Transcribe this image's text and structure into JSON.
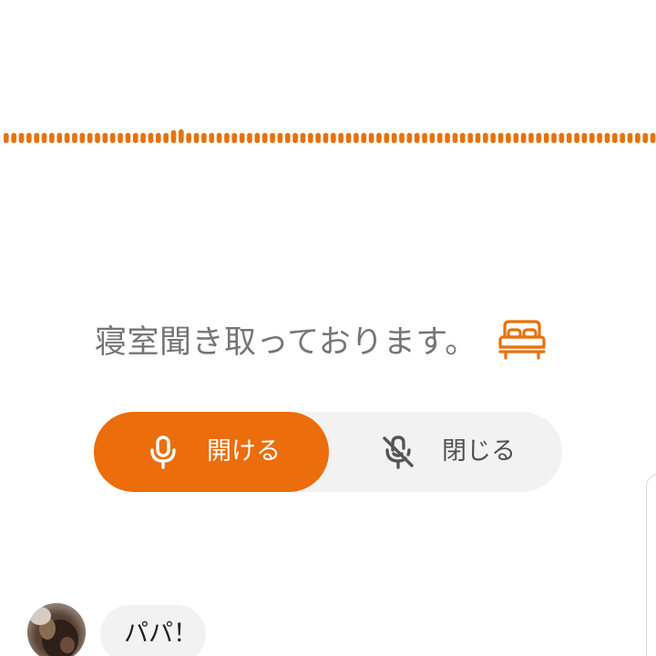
{
  "waveform": {
    "color": "#e8720c",
    "icon": "audio-waveform"
  },
  "status": {
    "text": "寝室聞き取っております。",
    "icon": "bed-icon",
    "icon_color": "#e8720c"
  },
  "toggle": {
    "open": {
      "label": "開ける",
      "icon": "microphone-icon",
      "selected": true,
      "background": "#ec6d0b"
    },
    "close": {
      "label": "閉じる",
      "icon": "microphone-off-icon",
      "selected": false
    }
  },
  "message": {
    "avatar_icon": "user-avatar",
    "text": "パパ！"
  }
}
